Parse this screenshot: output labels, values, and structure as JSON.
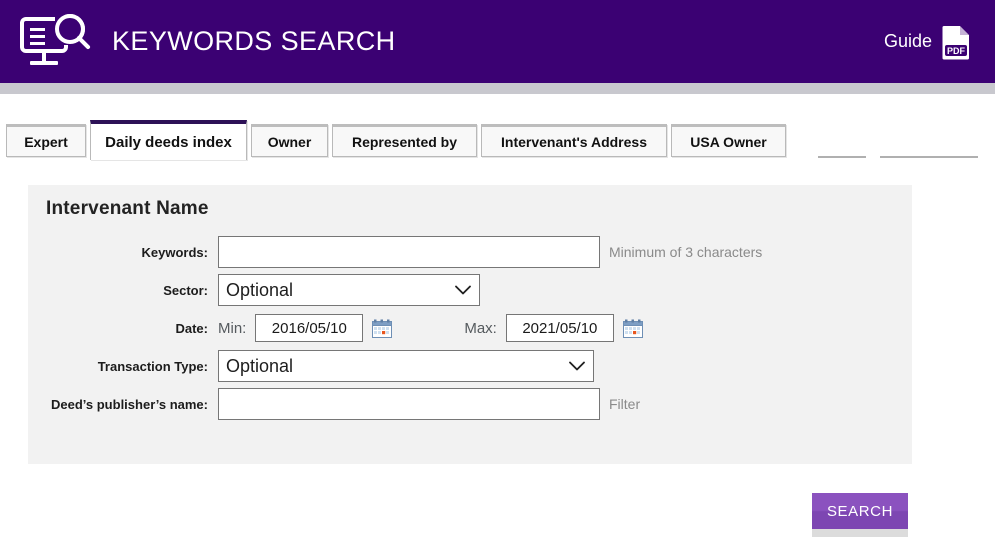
{
  "header": {
    "title": "KEYWORDS SEARCH",
    "logo_icon": "monitor-search-icon",
    "guide_label": "Guide",
    "guide_icon": "pdf-file-icon",
    "background_color": "#3b0173"
  },
  "tabs": [
    {
      "label": "Expert",
      "active": false
    },
    {
      "label": "Daily deeds index",
      "active": true
    },
    {
      "label": "Owner",
      "active": false
    },
    {
      "label": "Represented by",
      "active": false
    },
    {
      "label": "Intervenant's Address",
      "active": false
    },
    {
      "label": "USA Owner",
      "active": false
    }
  ],
  "panel": {
    "title": "Intervenant Name",
    "background_color": "#f2f2f2",
    "fields": {
      "keywords": {
        "label": "Keywords:",
        "value": "",
        "placeholder": "",
        "hint": "Minimum of 3 characters"
      },
      "sector": {
        "label": "Sector:",
        "selected": "Optional",
        "options": [
          "Optional"
        ],
        "icon": "chevron-down-icon"
      },
      "date": {
        "label": "Date:",
        "min_label": "Min:",
        "min_value": "2016/05/10",
        "max_label": "Max:",
        "max_value": "2021/05/10",
        "calendar_icon": "calendar-icon"
      },
      "transaction_type": {
        "label": "Transaction Type:",
        "selected": "Optional",
        "options": [
          "Optional"
        ],
        "icon": "chevron-down-icon"
      },
      "publisher": {
        "label": "Deed’s publisher’s name:",
        "value": "",
        "placeholder": "",
        "hint": "Filter"
      }
    }
  },
  "actions": {
    "search_label": "SEARCH",
    "search_color": "#8b52bf"
  }
}
